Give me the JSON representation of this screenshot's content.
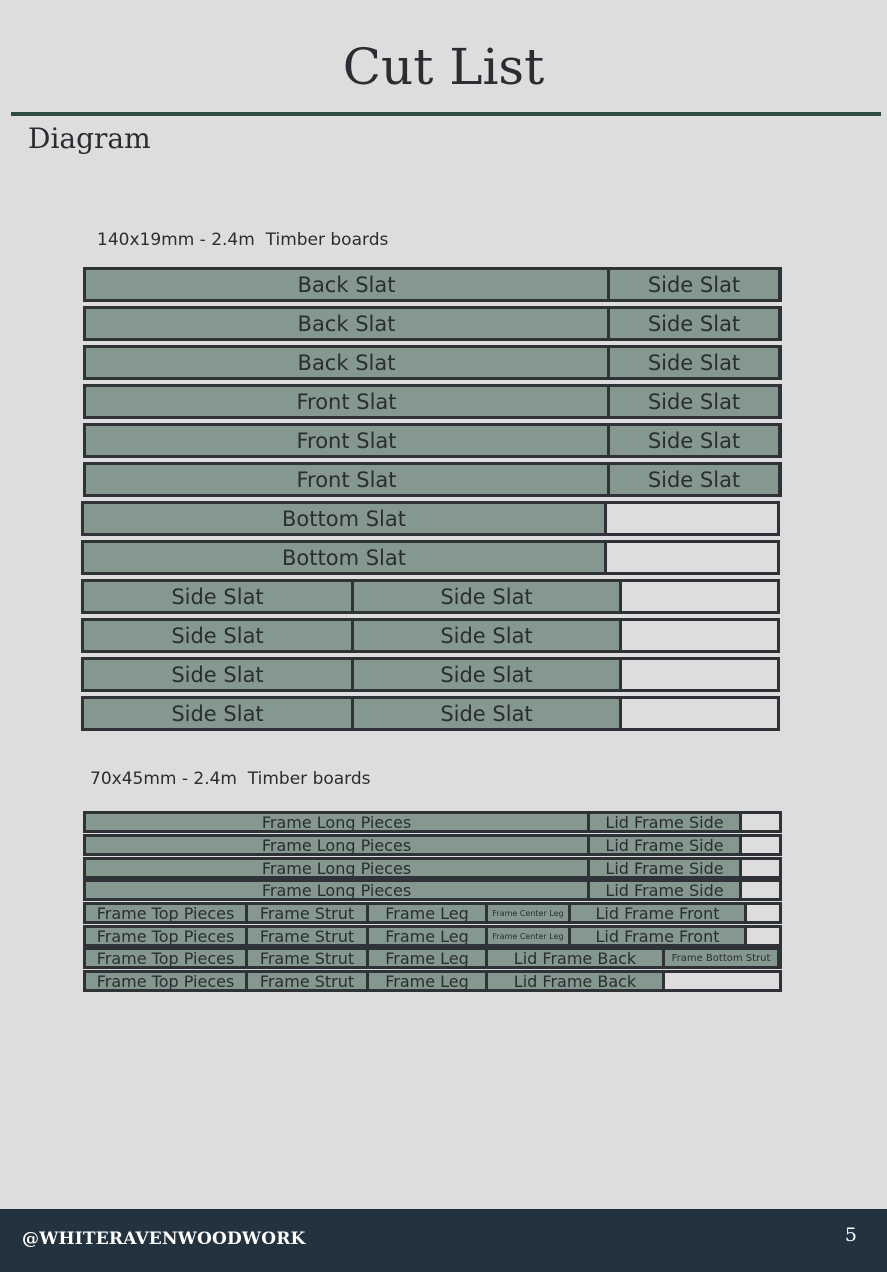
{
  "page": {
    "title": "Cut List",
    "section": "Diagram"
  },
  "groups": [
    {
      "label": "140x19mm - 2.4m  Timber boards",
      "boards": [
        [
          {
            "label": "Back Slat"
          },
          {
            "label": "Side Slat"
          }
        ],
        [
          {
            "label": "Back Slat"
          },
          {
            "label": "Side Slat"
          }
        ],
        [
          {
            "label": "Back Slat"
          },
          {
            "label": "Side Slat"
          }
        ],
        [
          {
            "label": "Front Slat"
          },
          {
            "label": "Side Slat"
          }
        ],
        [
          {
            "label": "Front Slat"
          },
          {
            "label": "Side Slat"
          }
        ],
        [
          {
            "label": "Front Slat"
          },
          {
            "label": "Side Slat"
          }
        ],
        [
          {
            "label": "Bottom Slat"
          }
        ],
        [
          {
            "label": "Bottom Slat"
          }
        ],
        [
          {
            "label": "Side Slat"
          },
          {
            "label": "Side Slat"
          }
        ],
        [
          {
            "label": "Side Slat"
          },
          {
            "label": "Side Slat"
          }
        ],
        [
          {
            "label": "Side Slat"
          },
          {
            "label": "Side Slat"
          }
        ],
        [
          {
            "label": "Side Slat"
          },
          {
            "label": "Side Slat"
          }
        ]
      ]
    },
    {
      "label": "70x45mm - 2.4m  Timber boards",
      "boards": [
        [
          {
            "label": "Frame Long Pieces"
          },
          {
            "label": "Lid Frame Side"
          }
        ],
        [
          {
            "label": "Frame Long Pieces"
          },
          {
            "label": "Lid Frame Side"
          }
        ],
        [
          {
            "label": "Frame Long Pieces"
          },
          {
            "label": "Lid Frame Side"
          }
        ],
        [
          {
            "label": "Frame Long Pieces"
          },
          {
            "label": "Lid Frame Side"
          }
        ],
        [
          {
            "label": "Frame Top Pieces"
          },
          {
            "label": "Frame Strut"
          },
          {
            "label": "Frame Leg"
          },
          {
            "label": "Frame Center Leg"
          },
          {
            "label": "Lid Frame Front"
          }
        ],
        [
          {
            "label": "Frame Top Pieces"
          },
          {
            "label": "Frame Strut"
          },
          {
            "label": "Frame Leg"
          },
          {
            "label": "Frame Center Leg"
          },
          {
            "label": "Lid Frame Front"
          }
        ],
        [
          {
            "label": "Frame Top Pieces"
          },
          {
            "label": "Frame Strut"
          },
          {
            "label": "Frame Leg"
          },
          {
            "label": "Lid Frame Back"
          },
          {
            "label": "Frame Bottom Strut"
          }
        ],
        [
          {
            "label": "Frame Top Pieces"
          },
          {
            "label": "Frame Strut"
          },
          {
            "label": "Frame Leg"
          },
          {
            "label": "Lid Frame Back"
          }
        ]
      ]
    }
  ],
  "footer": {
    "handle": "@WHITERAVENWOODWORK",
    "page_number": "5"
  },
  "colors": {
    "piece": "#84988f",
    "board_border": "#2f3237",
    "rule": "#2f4a3f",
    "footer_bg": "#23323f"
  }
}
